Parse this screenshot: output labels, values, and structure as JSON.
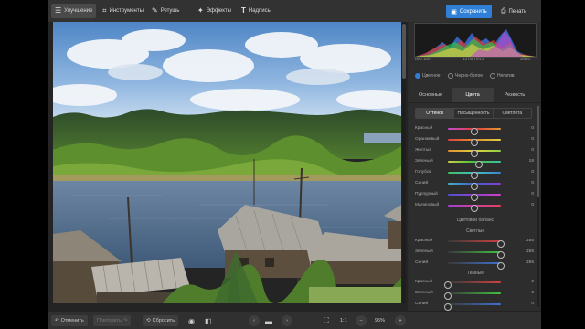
{
  "toolbar": {
    "tabs": [
      {
        "label": "Улучшение",
        "icon": "sliders-icon"
      },
      {
        "label": "Инструменты",
        "icon": "crop-icon"
      },
      {
        "label": "Ретушь",
        "icon": "brush-icon"
      },
      {
        "label": "Эффекты",
        "icon": "magic-wand-icon"
      },
      {
        "label": "Надпись",
        "icon": "text-icon"
      }
    ],
    "save_label": "Сохранить",
    "print_label": "Печать"
  },
  "histogram": {
    "iso": "ISO 100",
    "lens": "13 mm f/4.5",
    "shutter": "1/640"
  },
  "color_modes": {
    "options": [
      "Цветное",
      "Черно-белое",
      "Негатив"
    ],
    "selected": "Цветное"
  },
  "subtabs": {
    "items": [
      "Основные",
      "Цвета",
      "Резкость"
    ],
    "active": "Цвета"
  },
  "segments": {
    "items": [
      "Оттенок",
      "Насыщенность",
      "Светлота"
    ],
    "active": "Оттенок"
  },
  "hue_sliders": [
    {
      "label": "Красный",
      "value": "0",
      "level": 0.5
    },
    {
      "label": "Оранжевый",
      "value": "0",
      "level": 0.5
    },
    {
      "label": "Желтый",
      "value": "0",
      "level": 0.5
    },
    {
      "label": "Зеленый",
      "value": "18",
      "level": 0.59
    },
    {
      "label": "Голубой",
      "value": "0",
      "level": 0.5
    },
    {
      "label": "Синий",
      "value": "0",
      "level": 0.5
    },
    {
      "label": "Пурпурный",
      "value": "0",
      "level": 0.5
    },
    {
      "label": "Малиновый",
      "value": "0",
      "level": 0.5
    }
  ],
  "color_balance": {
    "title": "Цветовой баланс",
    "highlights_title": "Светлые",
    "highlights": [
      {
        "label": "Красный",
        "value": "255",
        "level": 1.0
      },
      {
        "label": "Зеленый",
        "value": "255",
        "level": 1.0
      },
      {
        "label": "Синий",
        "value": "255",
        "level": 1.0
      }
    ],
    "shadows_title": "Темные",
    "shadows": [
      {
        "label": "Красный",
        "value": "0",
        "level": 0.0
      },
      {
        "label": "Зеленый",
        "value": "0",
        "level": 0.0
      },
      {
        "label": "Синий",
        "value": "0",
        "level": 0.0
      }
    ]
  },
  "bottombar": {
    "undo_label": "Отменить",
    "redo_label": "Повторить",
    "reset_label": "Сбросить",
    "ratio_label": "1:1",
    "zoom_label": "95%"
  },
  "colors": {
    "accent": "#2f7fd6",
    "background": "#2b2b2b"
  }
}
